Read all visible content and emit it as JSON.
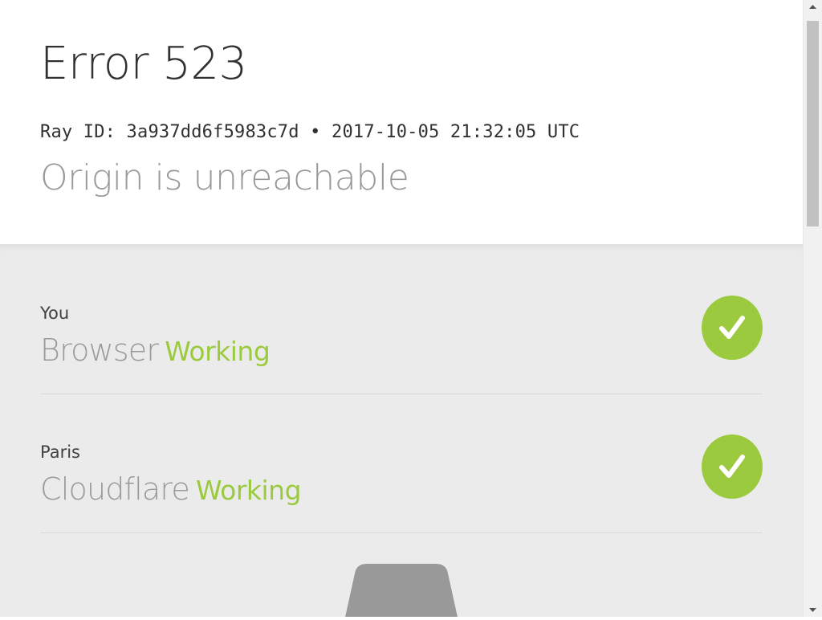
{
  "header": {
    "title": "Error 523",
    "ray_line": "Ray ID: 3a937dd6f5983c7d • 2017-10-05 21:32:05 UTC",
    "subtitle": "Origin is unreachable"
  },
  "status_rows": [
    {
      "location": "You",
      "name": "Browser",
      "status": "Working",
      "icon": "checkmark-icon"
    },
    {
      "location": "Paris",
      "name": "Cloudflare",
      "status": "Working",
      "icon": "checkmark-icon"
    }
  ],
  "host": {
    "icon": "host-server-icon"
  },
  "colors": {
    "working_green": "#9bca3e",
    "title_text": "#313131",
    "muted_text": "#999999",
    "panel_background": "#ebebeb",
    "host_icon": "#999999"
  }
}
